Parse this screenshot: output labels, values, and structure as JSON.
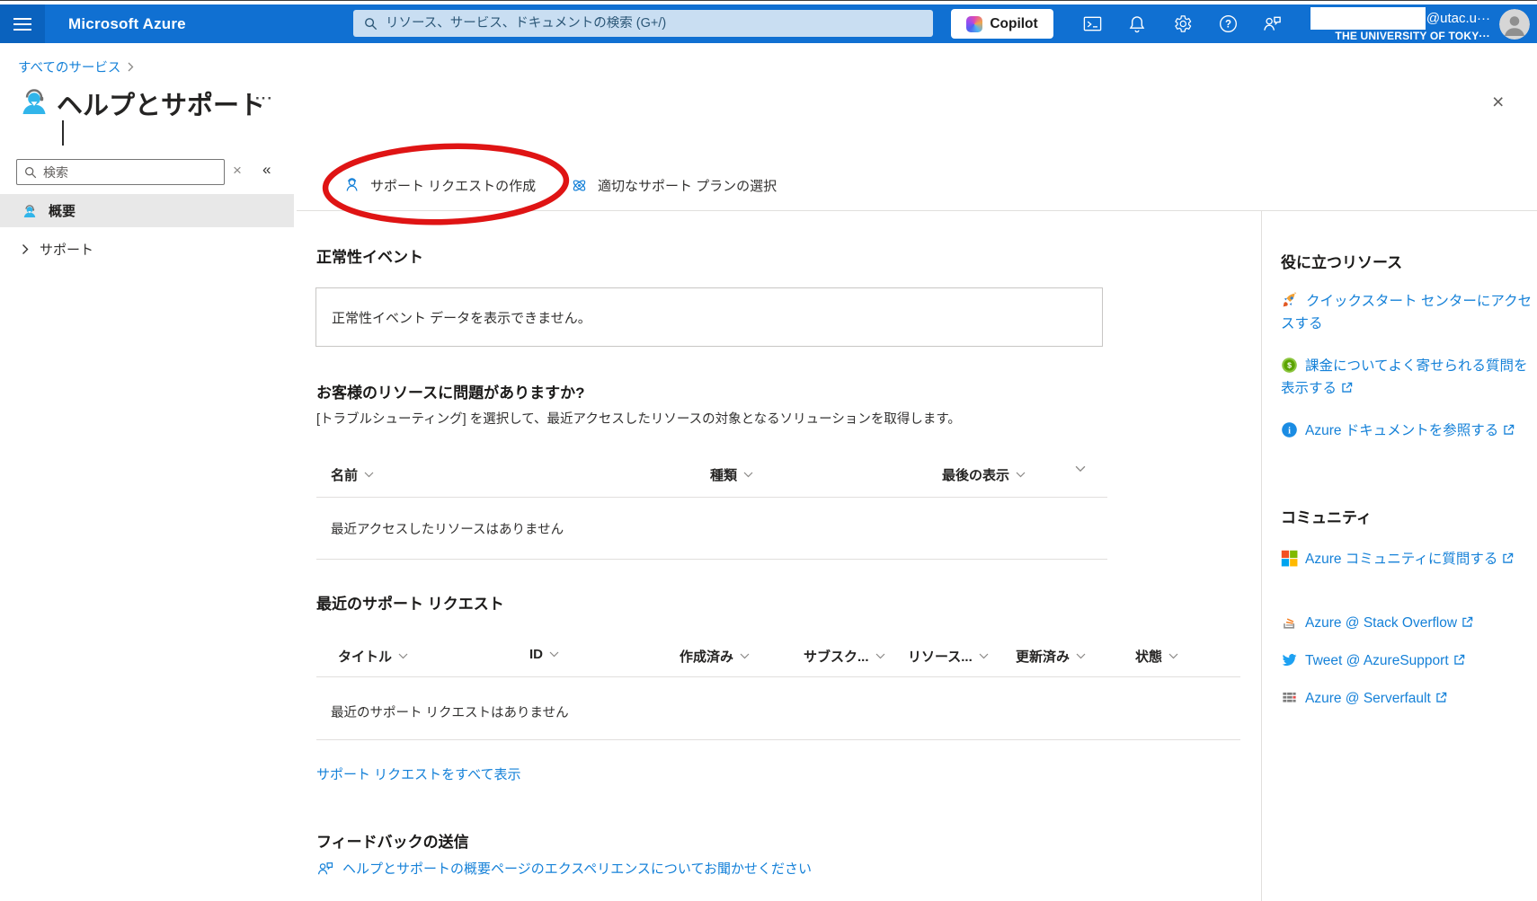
{
  "topbar": {
    "brand": "Microsoft Azure",
    "search_placeholder": "リソース、サービス、ドキュメントの検索 (G+/)",
    "copilot_label": "Copilot",
    "account": {
      "email": "@utac.u···",
      "org": "THE UNIVERSITY OF TOKY···"
    }
  },
  "breadcrumb": {
    "all_services": "すべてのサービス"
  },
  "page": {
    "title": "ヘルプとサポート",
    "more_label": "···",
    "close_label": "×"
  },
  "sidebar": {
    "search_placeholder": "検索",
    "clear_label": "×",
    "collapse_label": "«",
    "items": [
      {
        "label": "概要"
      },
      {
        "label": "サポート"
      }
    ]
  },
  "toolbar": {
    "create_request": "サポート リクエストの作成",
    "choose_plan": "適切なサポート プランの選択"
  },
  "health": {
    "title": "正常性イベント",
    "empty": "正常性イベント データを表示できません。"
  },
  "resources": {
    "title": "お客様のリソースに問題がありますか?",
    "description": "[トラブルシューティング] を選択して、最近アクセスしたリソースの対象となるソリューションを取得します。",
    "columns": [
      "名前",
      "種類",
      "最後の表示"
    ],
    "empty": "最近アクセスしたリソースはありません"
  },
  "requests": {
    "title": "最近のサポート リクエスト",
    "columns": [
      "タイトル",
      "ID",
      "作成済み",
      "サブスク...",
      "リソース...",
      "更新済み",
      "状態"
    ],
    "empty": "最近のサポート リクエストはありません",
    "view_all": "サポート リクエストをすべて表示"
  },
  "feedback": {
    "title": "フィードバックの送信",
    "link": "ヘルプとサポートの概要ページのエクスペリエンスについてお聞かせください"
  },
  "right_panel": {
    "resources_title": "役に立つリソース",
    "resource_links": [
      "クイックスタート センターにアクセスする",
      "課金についてよく寄せられる質問を表示する",
      "Azure ドキュメントを参照する"
    ],
    "community_title": "コミュニティ",
    "community_links": [
      "Azure コミュニティに質問する",
      "Azure @ Stack Overflow",
      "Tweet @ AzureSupport",
      "Azure @ Serverfault"
    ]
  },
  "colors": {
    "topbar_blue": "#1070d2",
    "link_blue": "#1581d8",
    "annotation_red": "#df1414"
  },
  "icons": {
    "hamburger": "☰",
    "search": "⌕",
    "cloud_shell": ">_",
    "notifications": "bell",
    "settings": "gear",
    "help": "?",
    "feedback": "person-chat",
    "avatar": "person",
    "support_person": "person-headset",
    "atom_plan": "⚛",
    "chevron_down": "∨",
    "chevron_right": "›",
    "collapse": "«",
    "external_link": "↗",
    "rocket": "🚀",
    "billing_coin": "$",
    "info": "i",
    "microsoft_logo": "⊞",
    "stack_overflow": "SO",
    "twitter": "bird",
    "serverfault": "SF"
  }
}
